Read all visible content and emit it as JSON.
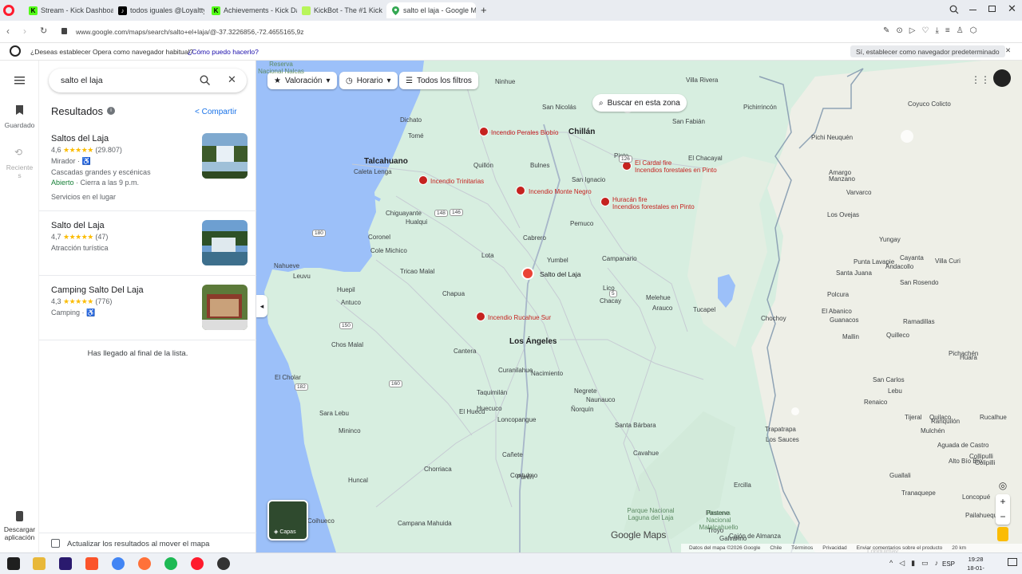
{
  "browser": {
    "tabs": [
      {
        "label": "Stream - Kick Dashboard",
        "favicon": "kick-icon"
      },
      {
        "label": "todos iguales @Loyaltty C",
        "favicon": "tiktok-icon"
      },
      {
        "label": "Achievements - Kick Dash",
        "favicon": "kick-icon"
      },
      {
        "label": "KickBot - The #1 Kick Bot",
        "favicon": "kickbot-icon"
      },
      {
        "label": "salto el laja - Google Map",
        "favicon": "maps-pin-icon",
        "active": true
      }
    ],
    "url": "www.google.com/maps/search/salto+el+laja/@-37.3226856,-72.4655165,9z",
    "infobar": {
      "message": "¿Deseas establecer Opera como navegador habitual?",
      "link": "¿Cómo puedo hacerlo?",
      "button": "Sí, establecer como navegador predeterminado"
    }
  },
  "rail": {
    "saved": "Guardado",
    "recent": "Recientes",
    "download": "Descargar aplicación"
  },
  "search": {
    "query": "salto el laja"
  },
  "results": {
    "header": "Resultados",
    "share": "Compartir",
    "items": [
      {
        "name": "Saltos del Laja",
        "rating": "4,6",
        "stars": "★★★★★",
        "reviews": "(29.807)",
        "category": "Mirador",
        "desc": "Cascadas grandes y escénicas",
        "status_open": "Abierto",
        "status_rest": " · Cierra a las 9 p.m.",
        "extra": "Servicios en el lugar"
      },
      {
        "name": "Salto del Laja",
        "rating": "4,7",
        "stars": "★★★★★",
        "reviews": "(47)",
        "category": "Atracción turística"
      },
      {
        "name": "Camping Salto Del Laja",
        "rating": "4,3",
        "stars": "★★★★★",
        "reviews": "(776)",
        "category": "Camping"
      }
    ],
    "end": "Has llegado al final de la lista.",
    "update_checkbox": "Actualizar los resultados al mover el mapa"
  },
  "map": {
    "chips": [
      "Valoración",
      "Horario",
      "Todos los filtros"
    ],
    "search_area": "Buscar en esta zona",
    "layers": "Capas",
    "logo": "Google Maps",
    "footer": [
      "Datos del mapa ©2026 Google",
      "Chile",
      "Términos",
      "Privacidad",
      "Enviar comentarios sobre el producto",
      "20 km"
    ],
    "fires": [
      {
        "name": "Incendio Perales Biobío"
      },
      {
        "name": "Incendio Trinitarias"
      },
      {
        "name": "Incendio Monte Negro"
      },
      {
        "name": "El Cardal fire",
        "sub": "Incendios forestales en Pinto"
      },
      {
        "name": "Huracán fire",
        "sub": "Incendios forestales en Pinto"
      },
      {
        "name": "Incendio Rucahue Sur"
      }
    ],
    "pin": "Salto del Laja",
    "cities": [
      "Chillán",
      "Talcahuano",
      "Los Ángeles"
    ],
    "places": [
      "Ninhue",
      "San Nicolás",
      "Villa Rivera",
      "Dichato",
      "San Fabián",
      "Pichirrincón",
      "Coyuco Colicto",
      "Tomé",
      "Pichi Neuquén",
      "Caleta Lenga",
      "Quillón",
      "Bulnes",
      "Pinto",
      "El Chacayal",
      "Manzano",
      "Amargo",
      "San Ignacio",
      "Chiguayante",
      "Hualqui",
      "Pemuco",
      "Varvarco",
      "Coronel",
      "Cabrero",
      "Los Ovejas",
      "Cole Michico",
      "Lota",
      "Yumbel",
      "Campanario",
      "Yungay",
      "Nahueve",
      "Tricao Malal",
      "Punta Lavapie",
      "Santa Juana",
      "Cayanta",
      "Andacollo",
      "Villa Curi",
      "Leuvu",
      "Chapua",
      "Lico",
      "San Rosendo",
      "Huepil",
      "Chacay",
      "Melehue",
      "Arauco",
      "Tucapel",
      "Polcura",
      "Antuco",
      "El Abanico",
      "Guanacos",
      "Ramadillas",
      "Chochoy",
      "Mallin",
      "Chos Malal",
      "Cantera",
      "Quilleco",
      "Pichachén",
      "El Cholar",
      "Curanilahue",
      "Nacimiento",
      "Huara",
      "Taquimilán",
      "Negrete",
      "San Carlos",
      "Lebu",
      "El Huecú",
      "Naunauco",
      "Renaico",
      "Santa Bárbara",
      "Quilaco",
      "Huecuco",
      "Ñorquín",
      "Tijeral",
      "Mulchén",
      "Rucalhue",
      "Sara Lebu",
      "Loncopangue",
      "Trapatrapa",
      "Ranquilón",
      "Colipilli",
      "Aguada de Castro",
      "Mininco",
      "Cavahue",
      "Alto Bío Bío",
      "Chorriaca",
      "Cañete",
      "Los Sauces",
      "Collipulli",
      "Huncal",
      "Contulmo",
      "Purén",
      "Ercilla",
      "Guallali",
      "Loncopué",
      "Coihueco",
      "Tranaquepe",
      "Pailahueque",
      "Campana Mahuida",
      "Pastene",
      "Galvarino",
      "Lonquimay",
      "Troyo",
      "Cajón de Almanza",
      "Parque Nacional Laguna del Laja",
      "Reserva Nacional Malalcahuello",
      "Reserva Nacional Nalcas"
    ],
    "routes": [
      "126",
      "148",
      "146",
      "180",
      "150",
      "160",
      "182",
      "5"
    ]
  },
  "taskbar": {
    "lang": "ESP",
    "time": "19:28",
    "date": "18-01-2026"
  }
}
